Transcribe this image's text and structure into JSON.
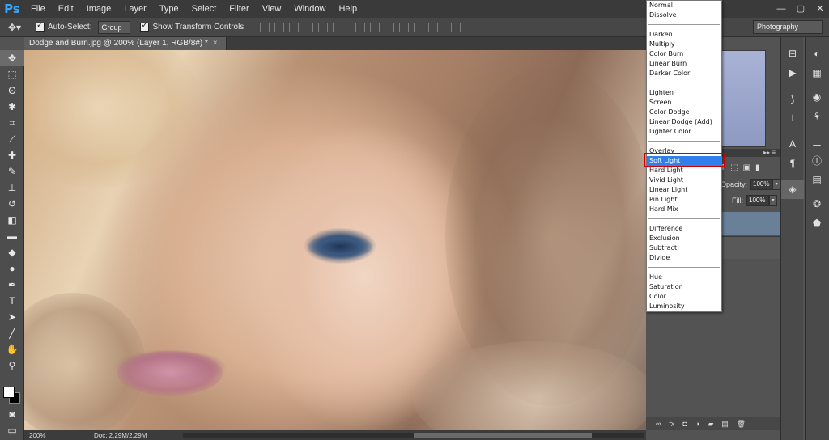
{
  "app": {
    "logo": "Ps"
  },
  "menu": [
    "File",
    "Edit",
    "Image",
    "Layer",
    "Type",
    "Select",
    "Filter",
    "View",
    "Window",
    "Help"
  ],
  "window_controls": [
    "—",
    "▢",
    "✕"
  ],
  "options": {
    "auto_select_label": "Auto-Select:",
    "auto_select_value": "Group",
    "transform_label": "Show Transform Controls",
    "workspace": "Photography"
  },
  "document": {
    "tab_title": "Dodge and Burn.jpg @ 200% (Layer 1, RGB/8#) *",
    "tab_close": "×"
  },
  "status": {
    "zoom": "200%",
    "doc_size": "Doc: 2.29M/2.29M"
  },
  "layers_panel": {
    "opacity_label": "Opacity:",
    "opacity_value": "100%",
    "fill_label": "Fill:",
    "fill_value": "100%"
  },
  "blend_modes": {
    "groups": [
      [
        "Normal",
        "Dissolve"
      ],
      [
        "Darken",
        "Multiply",
        "Color Burn",
        "Linear Burn",
        "Darker Color"
      ],
      [
        "Lighten",
        "Screen",
        "Color Dodge",
        "Linear Dodge (Add)",
        "Lighter Color"
      ],
      [
        "Overlay",
        "Soft Light",
        "Hard Light",
        "Vivid Light",
        "Linear Light",
        "Pin Light",
        "Hard Mix"
      ],
      [
        "Difference",
        "Exclusion",
        "Subtract",
        "Divide"
      ],
      [
        "Hue",
        "Saturation",
        "Color",
        "Luminosity"
      ]
    ],
    "selected": "Soft Light"
  },
  "colors": {
    "selection": "#2f80ed",
    "highlight_box": "#d40000",
    "brand": "#31a8ff"
  },
  "icons": {
    "tools": [
      "move-icon",
      "marquee-icon",
      "lasso-icon",
      "quick-select-icon",
      "crop-icon",
      "eyedropper-icon",
      "healing-brush-icon",
      "brush-icon",
      "clone-stamp-icon",
      "history-brush-icon",
      "eraser-icon",
      "gradient-icon",
      "blur-icon",
      "dodge-icon",
      "pen-icon",
      "type-icon",
      "path-select-icon",
      "shape-icon",
      "hand-icon",
      "zoom-icon"
    ],
    "dock_left": [
      "navigator-icon",
      "play-icon",
      "brush-preset-icon",
      "clone-source-icon",
      "character-icon",
      "paragraph-icon",
      "layers-icon"
    ],
    "dock_right": [
      "color-icon",
      "swatches-icon",
      "adjustments-icon",
      "styles-icon",
      "histogram-icon",
      "info-icon",
      "notes-icon",
      "channels-icon",
      "paths-icon",
      "character-styles-icon"
    ]
  }
}
